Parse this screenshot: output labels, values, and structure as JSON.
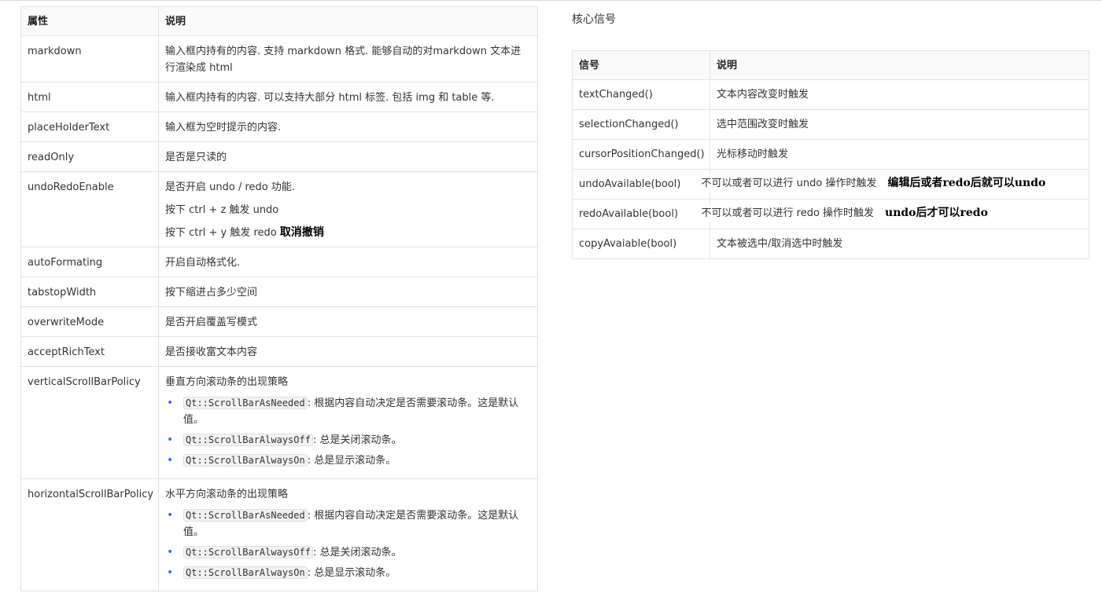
{
  "props_table": {
    "headers": [
      "属性",
      "说明"
    ],
    "rows": [
      {
        "name": "markdown",
        "lines": [
          "输入框内持有的内容. 支持 markdown 格式. 能够自动的对markdown 文本进行渲染成 html"
        ]
      },
      {
        "name": "html",
        "lines": [
          "输入框内持有的内容. 可以支持大部分 html 标签. 包括 img 和 table 等."
        ]
      },
      {
        "name": "placeHolderText",
        "lines": [
          "输入框为空时提示的内容."
        ]
      },
      {
        "name": "readOnly",
        "lines": [
          "是否是只读的"
        ]
      },
      {
        "name": "undoRedoEnable",
        "lines": [
          "是否开启 undo / redo 功能.",
          "按下 ctrl + z 触发 undo",
          "按下 ctrl + y 触发 redo"
        ],
        "note": "取消撤销"
      },
      {
        "name": "autoFormating",
        "lines": [
          "开启自动格式化."
        ]
      },
      {
        "name": "tabstopWidth",
        "lines": [
          "按下缩进占多少空间"
        ]
      },
      {
        "name": "overwriteMode",
        "lines": [
          "是否开启覆盖写模式"
        ]
      },
      {
        "name": "acceptRichText",
        "lines": [
          "是否接收富文本内容"
        ]
      },
      {
        "name": "verticalScrollBarPolicy",
        "lines": [
          "垂直方向滚动条的出现策略"
        ],
        "bullets": [
          {
            "code": "Qt::ScrollBarAsNeeded",
            "text": ": 根据内容自动决定是否需要滚动条。这是默认值。"
          },
          {
            "code": "Qt::ScrollBarAlwaysOff",
            "text": ": 总是关闭滚动条。"
          },
          {
            "code": "Qt::ScrollBarAlwaysOn",
            "text": ": 总是显示滚动条。"
          }
        ]
      },
      {
        "name": "horizontalScrollBarPolicy",
        "lines": [
          "水平方向滚动条的出现策略"
        ],
        "bullets": [
          {
            "code": "Qt::ScrollBarAsNeeded",
            "text": ": 根据内容自动决定是否需要滚动条。这是默认值。"
          },
          {
            "code": "Qt::ScrollBarAlwaysOff",
            "text": ": 总是关闭滚动条。"
          },
          {
            "code": "Qt::ScrollBarAlwaysOn",
            "text": ": 总是显示滚动条。"
          }
        ]
      }
    ]
  },
  "signals": {
    "title": "核心信号",
    "headers": [
      "信号",
      "说明"
    ],
    "rows": [
      {
        "name": "textChanged()",
        "desc": "文本内容改变时触发"
      },
      {
        "name": "selectionChanged()",
        "desc": "选中范围改变时触发"
      },
      {
        "name": "cursorPositionChanged()",
        "desc": "光标移动时触发"
      },
      {
        "name": "undoAvailable(bool)",
        "desc": "",
        "overlay": "不可以或者可以进行 undo 操作时触发",
        "note": "编辑后或者redo后就可以undo"
      },
      {
        "name": "redoAvailable(bool)",
        "desc": "",
        "overlay": "不可以或者可以进行 redo 操作时触发",
        "note": "undo后才可以redo"
      },
      {
        "name": "copyAvaiable(bool)",
        "desc": "文本被选中/取消选中时触发"
      }
    ]
  },
  "colors": {
    "bullet": "#3370ff",
    "border": "#e3e3e3",
    "code_bg": "#f2f2f2"
  }
}
